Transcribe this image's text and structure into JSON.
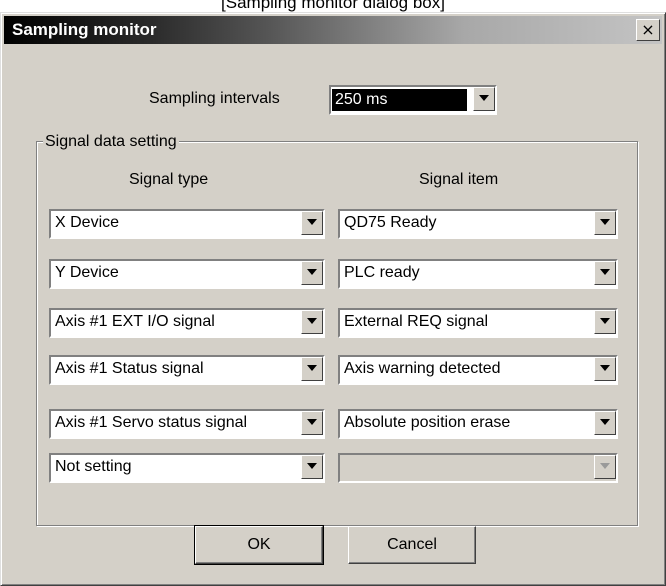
{
  "caption": "[Sampling monitor dialog box]",
  "window": {
    "title": "Sampling monitor",
    "close_glyph": "×"
  },
  "sampling": {
    "label": "Sampling intervals",
    "value": "250 ms"
  },
  "group": {
    "legend": "Signal data setting",
    "col_type": "Signal type",
    "col_item": "Signal item"
  },
  "rows": [
    {
      "type": "X Device",
      "item": "QD75 Ready"
    },
    {
      "type": "Y Device",
      "item": "PLC ready"
    },
    {
      "type": "Axis #1 EXT I/O signal",
      "item": "External REQ signal"
    },
    {
      "type": "Axis #1 Status signal",
      "item": "Axis warning detected"
    },
    {
      "type": "Axis #1 Servo status signal",
      "item": "Absolute position erase"
    },
    {
      "type": "Not setting",
      "item": ""
    }
  ],
  "buttons": {
    "ok": "OK",
    "cancel": "Cancel"
  },
  "colors": {
    "face": "#d4d0c8",
    "title_dark": "#000000",
    "selected_bg": "#000000"
  }
}
